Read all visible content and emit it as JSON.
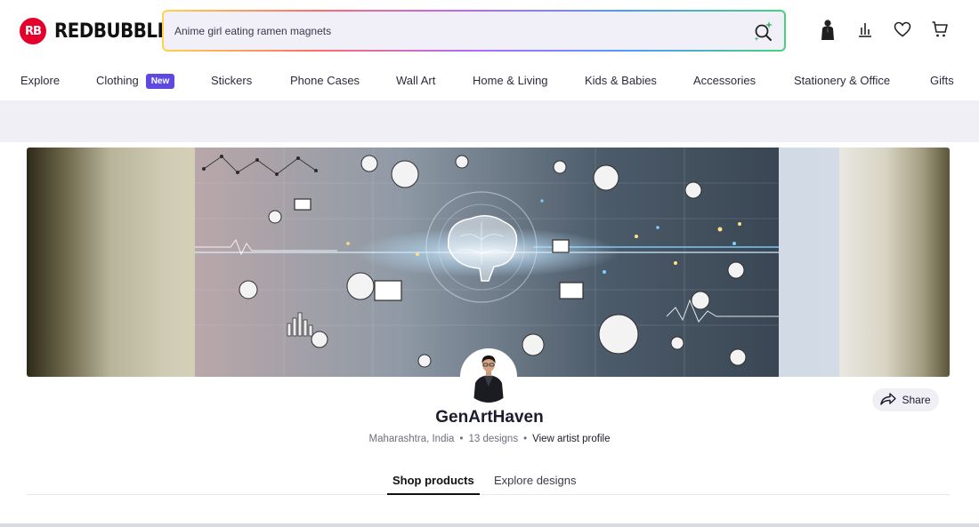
{
  "header": {
    "logo_mark": "RB",
    "logo_text": "REDBUBBLE",
    "search": {
      "value": "Anime girl eating ramen magnets",
      "placeholder": ""
    },
    "icons": [
      "account-icon",
      "dashboard-icon",
      "heart-icon",
      "cart-icon"
    ]
  },
  "nav": {
    "items": [
      {
        "label": "Explore"
      },
      {
        "label": "Clothing",
        "badge": "New"
      },
      {
        "label": "Stickers"
      },
      {
        "label": "Phone Cases"
      },
      {
        "label": "Wall Art"
      },
      {
        "label": "Home & Living"
      },
      {
        "label": "Kids & Babies"
      },
      {
        "label": "Accessories"
      },
      {
        "label": "Stationery & Office"
      },
      {
        "label": "Gifts"
      }
    ]
  },
  "artist": {
    "name": "GenArtHaven",
    "location": "Maharashtra, India",
    "designs": "13 designs",
    "separator": "•",
    "profile_link": "View artist profile",
    "share_label": "Share"
  },
  "tabs": {
    "items": [
      {
        "label": "Shop products",
        "active": true
      },
      {
        "label": "Explore designs",
        "active": false
      }
    ]
  },
  "colors": {
    "brand": "#e4002b",
    "badge": "#5d49e0",
    "band": "#f0eff5"
  }
}
